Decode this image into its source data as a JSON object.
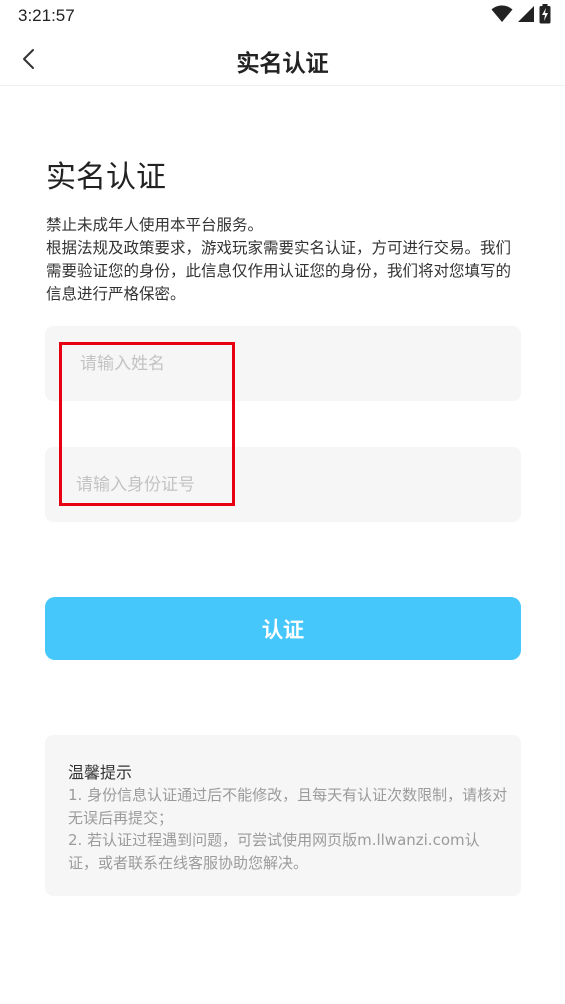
{
  "status_bar": {
    "time": "3:21:57"
  },
  "nav": {
    "title": "实名认证"
  },
  "page": {
    "title": "实名认证",
    "desc_line1": "禁止未成年人使用本平台服务。",
    "desc_line2": "根据法规及政策要求，游戏玩家需要实名认证，方可进行交易。我们需要验证您的身份，此信息仅作用认证您的身份，我们将对您填写的信息进行严格保密。"
  },
  "form": {
    "name_placeholder": "请输入姓名",
    "name_value": "",
    "id_placeholder": "请输入身份证号",
    "id_value": "",
    "submit_label": "认证"
  },
  "tips": {
    "title": "温馨提示",
    "item1": "1. 身份信息认证通过后不能修改，且每天有认证次数限制，请核对无误后再提交；",
    "item2": "2. 若认证过程遇到问题，可尝试使用网页版m.llwanzi.com认证，或者联系在线客服协助您解决。"
  },
  "colors": {
    "accent": "#45c7fb",
    "highlight": "#e60012",
    "input_bg": "#f6f6f6",
    "muted_text": "#9b9b9b"
  },
  "icons": {
    "wifi": "wifi-icon",
    "signal": "signal-icon",
    "battery": "battery-charging-icon",
    "back": "chevron-left-icon"
  }
}
